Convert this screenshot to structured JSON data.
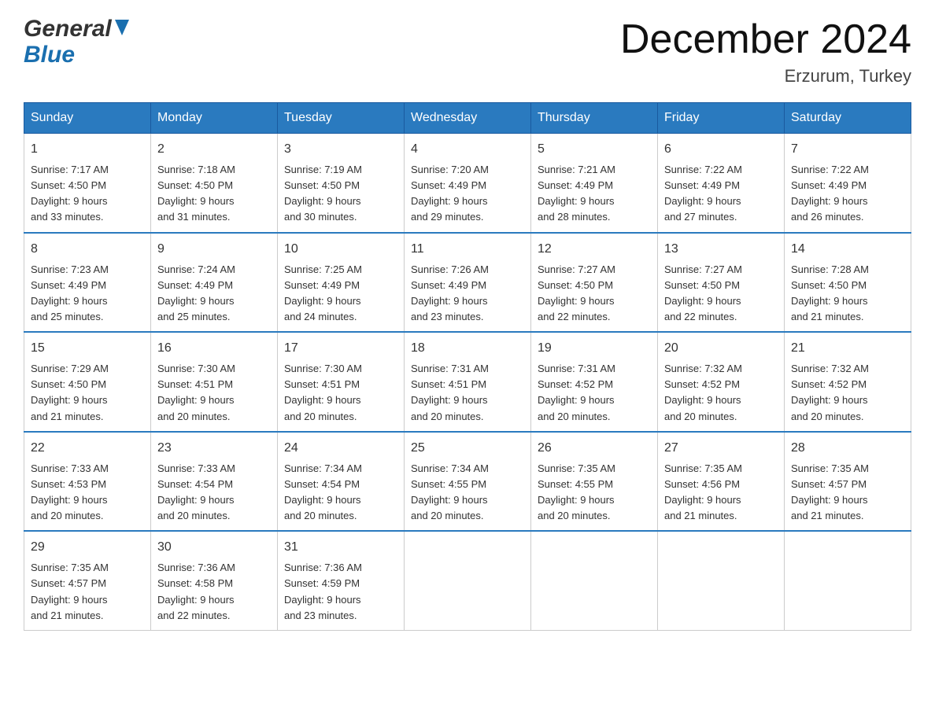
{
  "header": {
    "logo_general": "General",
    "logo_blue": "Blue",
    "month_title": "December 2024",
    "location": "Erzurum, Turkey"
  },
  "days_of_week": [
    "Sunday",
    "Monday",
    "Tuesday",
    "Wednesday",
    "Thursday",
    "Friday",
    "Saturday"
  ],
  "weeks": [
    [
      {
        "day": "1",
        "sunrise": "Sunrise: 7:17 AM",
        "sunset": "Sunset: 4:50 PM",
        "daylight": "Daylight: 9 hours",
        "daylight2": "and 33 minutes."
      },
      {
        "day": "2",
        "sunrise": "Sunrise: 7:18 AM",
        "sunset": "Sunset: 4:50 PM",
        "daylight": "Daylight: 9 hours",
        "daylight2": "and 31 minutes."
      },
      {
        "day": "3",
        "sunrise": "Sunrise: 7:19 AM",
        "sunset": "Sunset: 4:50 PM",
        "daylight": "Daylight: 9 hours",
        "daylight2": "and 30 minutes."
      },
      {
        "day": "4",
        "sunrise": "Sunrise: 7:20 AM",
        "sunset": "Sunset: 4:49 PM",
        "daylight": "Daylight: 9 hours",
        "daylight2": "and 29 minutes."
      },
      {
        "day": "5",
        "sunrise": "Sunrise: 7:21 AM",
        "sunset": "Sunset: 4:49 PM",
        "daylight": "Daylight: 9 hours",
        "daylight2": "and 28 minutes."
      },
      {
        "day": "6",
        "sunrise": "Sunrise: 7:22 AM",
        "sunset": "Sunset: 4:49 PM",
        "daylight": "Daylight: 9 hours",
        "daylight2": "and 27 minutes."
      },
      {
        "day": "7",
        "sunrise": "Sunrise: 7:22 AM",
        "sunset": "Sunset: 4:49 PM",
        "daylight": "Daylight: 9 hours",
        "daylight2": "and 26 minutes."
      }
    ],
    [
      {
        "day": "8",
        "sunrise": "Sunrise: 7:23 AM",
        "sunset": "Sunset: 4:49 PM",
        "daylight": "Daylight: 9 hours",
        "daylight2": "and 25 minutes."
      },
      {
        "day": "9",
        "sunrise": "Sunrise: 7:24 AM",
        "sunset": "Sunset: 4:49 PM",
        "daylight": "Daylight: 9 hours",
        "daylight2": "and 25 minutes."
      },
      {
        "day": "10",
        "sunrise": "Sunrise: 7:25 AM",
        "sunset": "Sunset: 4:49 PM",
        "daylight": "Daylight: 9 hours",
        "daylight2": "and 24 minutes."
      },
      {
        "day": "11",
        "sunrise": "Sunrise: 7:26 AM",
        "sunset": "Sunset: 4:49 PM",
        "daylight": "Daylight: 9 hours",
        "daylight2": "and 23 minutes."
      },
      {
        "day": "12",
        "sunrise": "Sunrise: 7:27 AM",
        "sunset": "Sunset: 4:50 PM",
        "daylight": "Daylight: 9 hours",
        "daylight2": "and 22 minutes."
      },
      {
        "day": "13",
        "sunrise": "Sunrise: 7:27 AM",
        "sunset": "Sunset: 4:50 PM",
        "daylight": "Daylight: 9 hours",
        "daylight2": "and 22 minutes."
      },
      {
        "day": "14",
        "sunrise": "Sunrise: 7:28 AM",
        "sunset": "Sunset: 4:50 PM",
        "daylight": "Daylight: 9 hours",
        "daylight2": "and 21 minutes."
      }
    ],
    [
      {
        "day": "15",
        "sunrise": "Sunrise: 7:29 AM",
        "sunset": "Sunset: 4:50 PM",
        "daylight": "Daylight: 9 hours",
        "daylight2": "and 21 minutes."
      },
      {
        "day": "16",
        "sunrise": "Sunrise: 7:30 AM",
        "sunset": "Sunset: 4:51 PM",
        "daylight": "Daylight: 9 hours",
        "daylight2": "and 20 minutes."
      },
      {
        "day": "17",
        "sunrise": "Sunrise: 7:30 AM",
        "sunset": "Sunset: 4:51 PM",
        "daylight": "Daylight: 9 hours",
        "daylight2": "and 20 minutes."
      },
      {
        "day": "18",
        "sunrise": "Sunrise: 7:31 AM",
        "sunset": "Sunset: 4:51 PM",
        "daylight": "Daylight: 9 hours",
        "daylight2": "and 20 minutes."
      },
      {
        "day": "19",
        "sunrise": "Sunrise: 7:31 AM",
        "sunset": "Sunset: 4:52 PM",
        "daylight": "Daylight: 9 hours",
        "daylight2": "and 20 minutes."
      },
      {
        "day": "20",
        "sunrise": "Sunrise: 7:32 AM",
        "sunset": "Sunset: 4:52 PM",
        "daylight": "Daylight: 9 hours",
        "daylight2": "and 20 minutes."
      },
      {
        "day": "21",
        "sunrise": "Sunrise: 7:32 AM",
        "sunset": "Sunset: 4:52 PM",
        "daylight": "Daylight: 9 hours",
        "daylight2": "and 20 minutes."
      }
    ],
    [
      {
        "day": "22",
        "sunrise": "Sunrise: 7:33 AM",
        "sunset": "Sunset: 4:53 PM",
        "daylight": "Daylight: 9 hours",
        "daylight2": "and 20 minutes."
      },
      {
        "day": "23",
        "sunrise": "Sunrise: 7:33 AM",
        "sunset": "Sunset: 4:54 PM",
        "daylight": "Daylight: 9 hours",
        "daylight2": "and 20 minutes."
      },
      {
        "day": "24",
        "sunrise": "Sunrise: 7:34 AM",
        "sunset": "Sunset: 4:54 PM",
        "daylight": "Daylight: 9 hours",
        "daylight2": "and 20 minutes."
      },
      {
        "day": "25",
        "sunrise": "Sunrise: 7:34 AM",
        "sunset": "Sunset: 4:55 PM",
        "daylight": "Daylight: 9 hours",
        "daylight2": "and 20 minutes."
      },
      {
        "day": "26",
        "sunrise": "Sunrise: 7:35 AM",
        "sunset": "Sunset: 4:55 PM",
        "daylight": "Daylight: 9 hours",
        "daylight2": "and 20 minutes."
      },
      {
        "day": "27",
        "sunrise": "Sunrise: 7:35 AM",
        "sunset": "Sunset: 4:56 PM",
        "daylight": "Daylight: 9 hours",
        "daylight2": "and 21 minutes."
      },
      {
        "day": "28",
        "sunrise": "Sunrise: 7:35 AM",
        "sunset": "Sunset: 4:57 PM",
        "daylight": "Daylight: 9 hours",
        "daylight2": "and 21 minutes."
      }
    ],
    [
      {
        "day": "29",
        "sunrise": "Sunrise: 7:35 AM",
        "sunset": "Sunset: 4:57 PM",
        "daylight": "Daylight: 9 hours",
        "daylight2": "and 21 minutes."
      },
      {
        "day": "30",
        "sunrise": "Sunrise: 7:36 AM",
        "sunset": "Sunset: 4:58 PM",
        "daylight": "Daylight: 9 hours",
        "daylight2": "and 22 minutes."
      },
      {
        "day": "31",
        "sunrise": "Sunrise: 7:36 AM",
        "sunset": "Sunset: 4:59 PM",
        "daylight": "Daylight: 9 hours",
        "daylight2": "and 23 minutes."
      },
      null,
      null,
      null,
      null
    ]
  ]
}
